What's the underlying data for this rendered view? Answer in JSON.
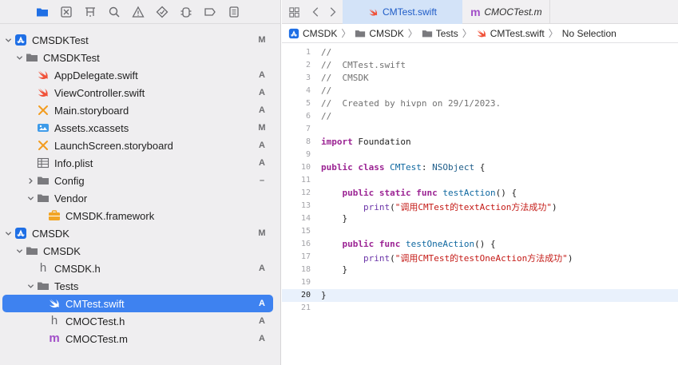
{
  "navigator": {
    "toolbar_icons": [
      "folder-icon",
      "source-control-icon",
      "symbol-icon",
      "find-icon",
      "issue-icon",
      "test-icon",
      "debug-icon",
      "breakpoint-icon",
      "report-icon"
    ],
    "tree": [
      {
        "label": "CMSDKTest",
        "status": "M",
        "depth": 0,
        "kind": "project",
        "disclosure": "open"
      },
      {
        "label": "CMSDKTest",
        "status": "",
        "depth": 1,
        "kind": "folder",
        "disclosure": "open"
      },
      {
        "label": "AppDelegate.swift",
        "status": "A",
        "depth": 2,
        "kind": "swift",
        "disclosure": "none"
      },
      {
        "label": "ViewController.swift",
        "status": "A",
        "depth": 2,
        "kind": "swift",
        "disclosure": "none"
      },
      {
        "label": "Main.storyboard",
        "status": "A",
        "depth": 2,
        "kind": "storyboard",
        "disclosure": "none"
      },
      {
        "label": "Assets.xcassets",
        "status": "M",
        "depth": 2,
        "kind": "assets",
        "disclosure": "none"
      },
      {
        "label": "LaunchScreen.storyboard",
        "status": "A",
        "depth": 2,
        "kind": "storyboard",
        "disclosure": "none"
      },
      {
        "label": "Info.plist",
        "status": "A",
        "depth": 2,
        "kind": "plist",
        "disclosure": "none"
      },
      {
        "label": "Config",
        "status": "–",
        "depth": 2,
        "kind": "folder",
        "disclosure": "closed"
      },
      {
        "label": "Vendor",
        "status": "",
        "depth": 2,
        "kind": "folder",
        "disclosure": "open"
      },
      {
        "label": "CMSDK.framework",
        "status": "",
        "depth": 3,
        "kind": "framework",
        "disclosure": "none"
      },
      {
        "label": "CMSDK",
        "status": "M",
        "depth": 0,
        "kind": "project",
        "disclosure": "open"
      },
      {
        "label": "CMSDK",
        "status": "",
        "depth": 1,
        "kind": "folder",
        "disclosure": "open"
      },
      {
        "label": "CMSDK.h",
        "status": "A",
        "depth": 2,
        "kind": "header",
        "disclosure": "none"
      },
      {
        "label": "Tests",
        "status": "",
        "depth": 2,
        "kind": "folder",
        "disclosure": "open"
      },
      {
        "label": "CMTest.swift",
        "status": "A",
        "depth": 3,
        "kind": "swift",
        "disclosure": "none",
        "selected": true
      },
      {
        "label": "CMOCTest.h",
        "status": "A",
        "depth": 3,
        "kind": "header",
        "disclosure": "none"
      },
      {
        "label": "CMOCTest.m",
        "status": "A",
        "depth": 3,
        "kind": "objc",
        "disclosure": "none"
      }
    ]
  },
  "editor": {
    "tabs": [
      {
        "label": "CMTest.swift",
        "icon": "swift-icon",
        "active": true
      },
      {
        "label": "CMOCTest.m",
        "icon": "objc-m-icon",
        "active": false
      }
    ],
    "jumpbar": [
      {
        "label": "CMSDK",
        "icon": "project-icon"
      },
      {
        "label": "CMSDK",
        "icon": "folder-icon"
      },
      {
        "label": "Tests",
        "icon": "folder-icon"
      },
      {
        "label": "CMTest.swift",
        "icon": "swift-icon"
      },
      {
        "label": "No Selection",
        "icon": ""
      }
    ],
    "current_line": 20,
    "code_lines": [
      "//",
      "//  CMTest.swift",
      "//  CMSDK",
      "//",
      "//  Created by hivpn on 29/1/2023.",
      "//",
      "",
      "import Foundation",
      "",
      "public class CMTest: NSObject {",
      "",
      "    public static func testAction() {",
      "        print(\"调用CMTest的textAction方法成功\")",
      "    }",
      "",
      "    public func testOneAction() {",
      "        print(\"调用CMTest的testOneAction方法成功\")",
      "    }",
      "",
      "}",
      ""
    ]
  },
  "colors": {
    "selection": "#3e82f0",
    "swift_orange": "#f05138",
    "xcode_blue": "#1f6fe5",
    "objc_purple": "#a14ec8"
  }
}
